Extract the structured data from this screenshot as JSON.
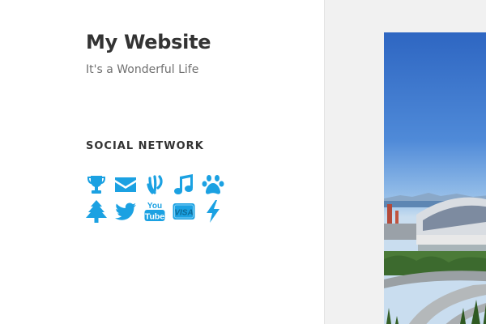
{
  "site": {
    "title": "My Website",
    "description": "It's a Wonderful Life"
  },
  "widget": {
    "title": "SOCIAL NETWORK",
    "icons": [
      "trophy-icon",
      "mail-icon",
      "vine-icon",
      "music-icon",
      "paw-icon",
      "tree-icon",
      "twitter-icon",
      "youtube-icon",
      "visa-icon",
      "lightning-icon"
    ],
    "youtube_text_1": "You",
    "youtube_text_2": "Tube",
    "visa_text": "VISA"
  },
  "colors": {
    "icon": "#1ba1e2",
    "title": "#333333",
    "description": "#707070",
    "content_bg": "#f1f1f1"
  }
}
